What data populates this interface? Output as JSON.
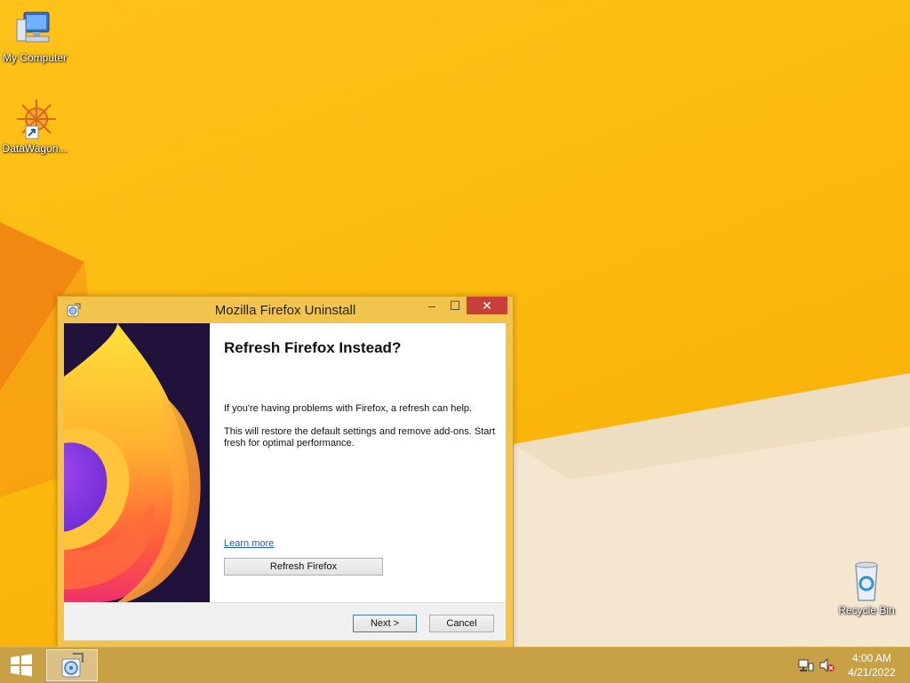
{
  "desktop": {
    "icons": [
      {
        "label": "My Computer",
        "icon": "computer-icon"
      },
      {
        "label": "DataWagon...",
        "icon": "datawagon-icon"
      },
      {
        "label": "Recycle Bin",
        "icon": "recycle-bin-icon"
      }
    ]
  },
  "window": {
    "title": "Mozilla Firefox Uninstall",
    "controls": {
      "minimize": "–",
      "maximize": "☐",
      "close": "✕"
    },
    "heading": "Refresh Firefox Instead?",
    "paragraph1": "If you're having problems with Firefox, a refresh can help.",
    "paragraph2": "This will restore the default settings and remove add-ons. Start fresh for optimal performance.",
    "learn_more": "Learn more",
    "refresh_button": "Refresh Firefox",
    "next_button": "Next >",
    "cancel_button": "Cancel"
  },
  "taskbar": {
    "start_icon": "windows-logo-icon",
    "running_app_icon": "uninstaller-icon",
    "tray": [
      "network-icon",
      "volume-muted-icon"
    ],
    "time": "4:00 AM",
    "date": "4/21/2022"
  },
  "colors": {
    "wallpaper": "#fbb80c",
    "window_frame": "#f3c44d",
    "close_button": "#c7413a",
    "taskbar": "#c8a046",
    "link": "#1a5fb4"
  }
}
